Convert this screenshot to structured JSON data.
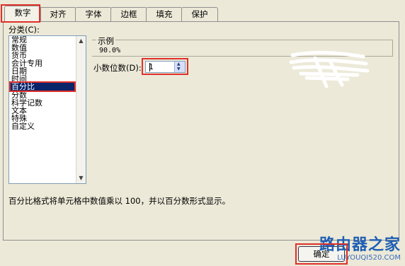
{
  "tabs": [
    "数字",
    "对齐",
    "字体",
    "边框",
    "填充",
    "保护"
  ],
  "category_label": "分类(C):",
  "categories": [
    "常规",
    "数值",
    "货币",
    "会计专用",
    "日期",
    "时间",
    "百分比",
    "分数",
    "科学记数",
    "文本",
    "特殊",
    "自定义"
  ],
  "selected_category": "百分比",
  "sample": {
    "legend": "示例",
    "value": "90.0%"
  },
  "decimal_places": {
    "label": "小数位数(D):",
    "value": "1"
  },
  "description": "百分比格式将单元格中数值乘以 100，并以百分数形式显示。",
  "ok_button": "确定",
  "watermark": {
    "title": "路由器之家",
    "url": "LUYOUQI520.COM"
  },
  "colors": {
    "highlight": "#e0302a",
    "selection": "#0a246a",
    "background": "#ece9d8"
  }
}
